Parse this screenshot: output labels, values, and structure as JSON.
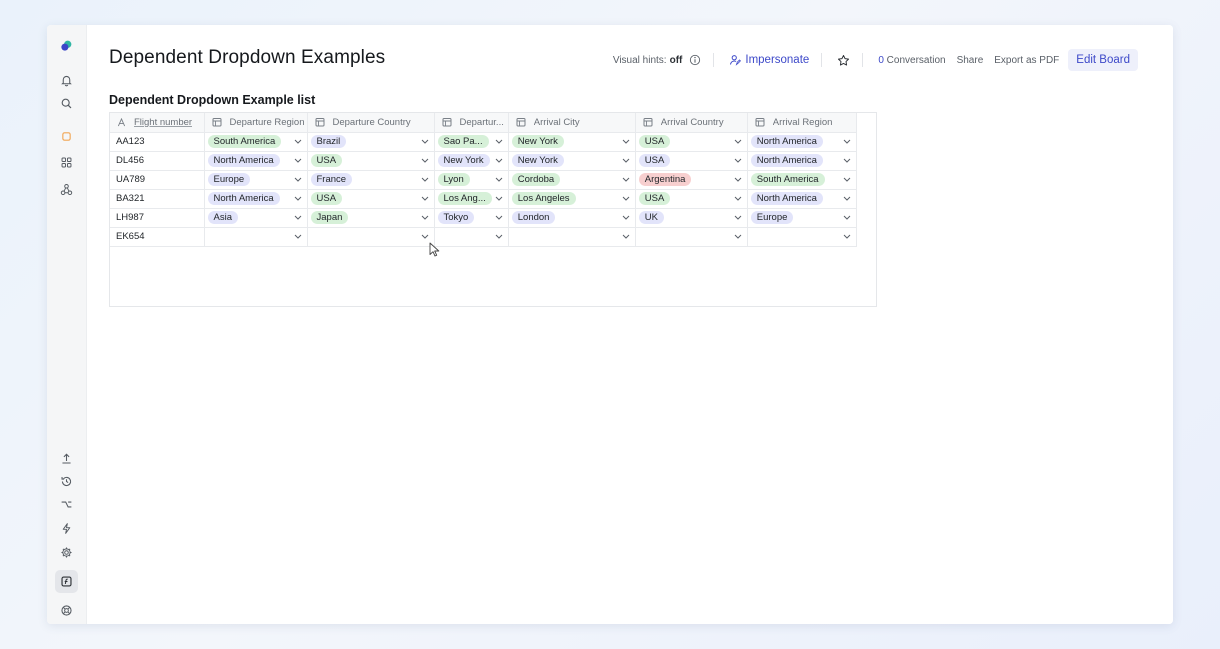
{
  "page": {
    "title": "Dependent Dropdown Examples"
  },
  "topbar": {
    "visual_hints_label": "Visual hints:",
    "visual_hints_value": "off",
    "impersonate_label": "Impersonate",
    "conversation_count": "0",
    "conversation_label": "Conversation",
    "share_label": "Share",
    "export_label": "Export as PDF",
    "edit_board_label": "Edit Board"
  },
  "sidebar": {
    "top_items": [
      "logo-icon",
      "bell-icon",
      "search-icon",
      "square-icon",
      "grid-icon",
      "nodes-icon"
    ],
    "bottom_items": [
      "upload-icon",
      "history-icon",
      "branch-icon",
      "bolt-icon",
      "gear-icon",
      "formula-icon",
      "help-icon"
    ]
  },
  "list": {
    "title": "Dependent Dropdown Example list",
    "columns": [
      {
        "label": "Flight number",
        "icon": "text-type-icon"
      },
      {
        "label": "Departure Region",
        "icon": "calendar-type-icon"
      },
      {
        "label": "Departure Country",
        "icon": "calendar-type-icon"
      },
      {
        "label": "Departur...",
        "icon": "calendar-type-icon"
      },
      {
        "label": "Arrival City",
        "icon": "calendar-type-icon"
      },
      {
        "label": "Arrival Country",
        "icon": "calendar-type-icon"
      },
      {
        "label": "Arrival Region",
        "icon": "calendar-type-icon"
      }
    ],
    "rows": [
      {
        "flight": "AA123",
        "cells": [
          {
            "text": "South America",
            "color": "green"
          },
          {
            "text": "Brazil",
            "color": "purple"
          },
          {
            "text": "Sao Pa...",
            "color": "green"
          },
          {
            "text": "New York",
            "color": "green"
          },
          {
            "text": "USA",
            "color": "green"
          },
          {
            "text": "North America",
            "color": "purple"
          }
        ]
      },
      {
        "flight": "DL456",
        "cells": [
          {
            "text": "North America",
            "color": "purple"
          },
          {
            "text": "USA",
            "color": "green"
          },
          {
            "text": "New York",
            "color": "purple"
          },
          {
            "text": "New York",
            "color": "purple"
          },
          {
            "text": "USA",
            "color": "purple"
          },
          {
            "text": "North America",
            "color": "purple"
          }
        ]
      },
      {
        "flight": "UA789",
        "cells": [
          {
            "text": "Europe",
            "color": "purple"
          },
          {
            "text": "France",
            "color": "purple"
          },
          {
            "text": "Lyon",
            "color": "green"
          },
          {
            "text": "Cordoba",
            "color": "green"
          },
          {
            "text": "Argentina",
            "color": "red"
          },
          {
            "text": "South America",
            "color": "green"
          }
        ]
      },
      {
        "flight": "BA321",
        "cells": [
          {
            "text": "North America",
            "color": "purple"
          },
          {
            "text": "USA",
            "color": "green"
          },
          {
            "text": "Los Ang...",
            "color": "green"
          },
          {
            "text": "Los Angeles",
            "color": "green"
          },
          {
            "text": "USA",
            "color": "green"
          },
          {
            "text": "North America",
            "color": "purple"
          }
        ]
      },
      {
        "flight": "LH987",
        "cells": [
          {
            "text": "Asia",
            "color": "purple"
          },
          {
            "text": "Japan",
            "color": "green"
          },
          {
            "text": "Tokyo",
            "color": "purple"
          },
          {
            "text": "London",
            "color": "purple"
          },
          {
            "text": "UK",
            "color": "purple"
          },
          {
            "text": "Europe",
            "color": "purple"
          }
        ]
      },
      {
        "flight": "EK654",
        "cells": [
          {
            "text": "",
            "color": ""
          },
          {
            "text": "",
            "color": ""
          },
          {
            "text": "",
            "color": ""
          },
          {
            "text": "",
            "color": ""
          },
          {
            "text": "",
            "color": ""
          },
          {
            "text": "",
            "color": ""
          }
        ]
      }
    ]
  },
  "colors": {
    "accent": "#3d49c9",
    "chip_green": "#d6f0d8",
    "chip_purple": "#e2e4fa",
    "chip_red": "#f7cfcf"
  }
}
